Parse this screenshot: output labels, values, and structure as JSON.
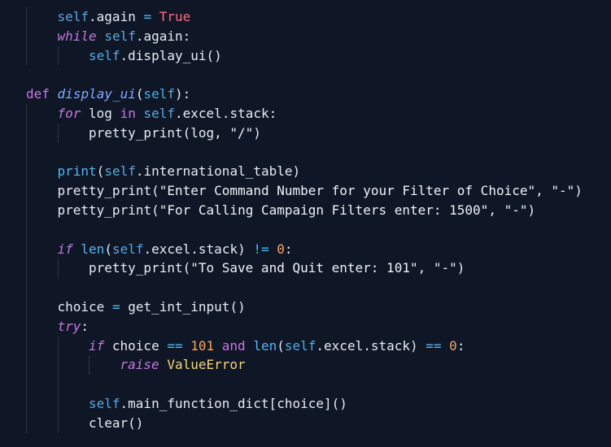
{
  "theme": {
    "background": "#0f1626",
    "keyword": "#c678dd",
    "self": "#56a9e0",
    "string": "#eef2f7",
    "number": "#f3a665",
    "boolean": "#ff6b81",
    "builtin": "#56b6f2",
    "class_name": "#f7d478",
    "def_name": "#82aaff"
  },
  "code": {
    "lines": [
      {
        "indent": 1,
        "tokens": [
          {
            "t": "self",
            "k": "self"
          },
          {
            "t": ".again ",
            "k": "plain"
          },
          {
            "t": "=",
            "k": "op"
          },
          {
            "t": " ",
            "k": "plain"
          },
          {
            "t": "True",
            "k": "bool"
          }
        ]
      },
      {
        "indent": 1,
        "tokens": [
          {
            "t": "while",
            "k": "kw-i"
          },
          {
            "t": " ",
            "k": "plain"
          },
          {
            "t": "self",
            "k": "self"
          },
          {
            "t": ".again:",
            "k": "plain"
          }
        ]
      },
      {
        "indent": 2,
        "tokens": [
          {
            "t": "self",
            "k": "self"
          },
          {
            "t": ".display_ui()",
            "k": "plain"
          }
        ]
      },
      {
        "indent": 0,
        "tokens": []
      },
      {
        "indent": 0,
        "tokens": [
          {
            "t": "def",
            "k": "kw"
          },
          {
            "t": " ",
            "k": "plain"
          },
          {
            "t": "display_ui",
            "k": "deffn"
          },
          {
            "t": "(",
            "k": "plain"
          },
          {
            "t": "self",
            "k": "self"
          },
          {
            "t": "):",
            "k": "plain"
          }
        ]
      },
      {
        "indent": 1,
        "tokens": [
          {
            "t": "for",
            "k": "kw-i"
          },
          {
            "t": " log ",
            "k": "plain"
          },
          {
            "t": "in",
            "k": "kw"
          },
          {
            "t": " ",
            "k": "plain"
          },
          {
            "t": "self",
            "k": "self"
          },
          {
            "t": ".excel.stack:",
            "k": "plain"
          }
        ]
      },
      {
        "indent": 2,
        "tokens": [
          {
            "t": "pretty_print(log, ",
            "k": "plain"
          },
          {
            "t": "\"/\"",
            "k": "str"
          },
          {
            "t": ")",
            "k": "plain"
          }
        ]
      },
      {
        "indent": 0,
        "tokens": []
      },
      {
        "indent": 1,
        "tokens": [
          {
            "t": "print",
            "k": "builtin"
          },
          {
            "t": "(",
            "k": "plain"
          },
          {
            "t": "self",
            "k": "self"
          },
          {
            "t": ".international_table)",
            "k": "plain"
          }
        ]
      },
      {
        "indent": 1,
        "tokens": [
          {
            "t": "pretty_print(",
            "k": "plain"
          },
          {
            "t": "\"Enter Command Number for your Filter of Choice\"",
            "k": "str"
          },
          {
            "t": ", ",
            "k": "plain"
          },
          {
            "t": "\"-\"",
            "k": "str"
          },
          {
            "t": ")",
            "k": "plain"
          }
        ]
      },
      {
        "indent": 1,
        "tokens": [
          {
            "t": "pretty_print(",
            "k": "plain"
          },
          {
            "t": "\"For Calling Campaign Filters enter: 1500\"",
            "k": "str"
          },
          {
            "t": ", ",
            "k": "plain"
          },
          {
            "t": "\"-\"",
            "k": "str"
          },
          {
            "t": ")",
            "k": "plain"
          }
        ]
      },
      {
        "indent": 0,
        "tokens": []
      },
      {
        "indent": 1,
        "tokens": [
          {
            "t": "if",
            "k": "kw-i"
          },
          {
            "t": " ",
            "k": "plain"
          },
          {
            "t": "len",
            "k": "builtin"
          },
          {
            "t": "(",
            "k": "plain"
          },
          {
            "t": "self",
            "k": "self"
          },
          {
            "t": ".excel.stack) ",
            "k": "plain"
          },
          {
            "t": "!=",
            "k": "op"
          },
          {
            "t": " ",
            "k": "plain"
          },
          {
            "t": "0",
            "k": "num"
          },
          {
            "t": ":",
            "k": "plain"
          }
        ]
      },
      {
        "indent": 2,
        "tokens": [
          {
            "t": "pretty_print(",
            "k": "plain"
          },
          {
            "t": "\"To Save and Quit enter: 101\"",
            "k": "str"
          },
          {
            "t": ", ",
            "k": "plain"
          },
          {
            "t": "\"-\"",
            "k": "str"
          },
          {
            "t": ")",
            "k": "plain"
          }
        ]
      },
      {
        "indent": 0,
        "tokens": []
      },
      {
        "indent": 1,
        "tokens": [
          {
            "t": "choice ",
            "k": "plain"
          },
          {
            "t": "=",
            "k": "op"
          },
          {
            "t": " get_int_input()",
            "k": "plain"
          }
        ]
      },
      {
        "indent": 1,
        "tokens": [
          {
            "t": "try",
            "k": "kw-i"
          },
          {
            "t": ":",
            "k": "plain"
          }
        ]
      },
      {
        "indent": 2,
        "tokens": [
          {
            "t": "if",
            "k": "kw-i"
          },
          {
            "t": " choice ",
            "k": "plain"
          },
          {
            "t": "==",
            "k": "op"
          },
          {
            "t": " ",
            "k": "plain"
          },
          {
            "t": "101",
            "k": "num"
          },
          {
            "t": " ",
            "k": "plain"
          },
          {
            "t": "and",
            "k": "kw"
          },
          {
            "t": " ",
            "k": "plain"
          },
          {
            "t": "len",
            "k": "builtin"
          },
          {
            "t": "(",
            "k": "plain"
          },
          {
            "t": "self",
            "k": "self"
          },
          {
            "t": ".excel.stack) ",
            "k": "plain"
          },
          {
            "t": "==",
            "k": "op"
          },
          {
            "t": " ",
            "k": "plain"
          },
          {
            "t": "0",
            "k": "num"
          },
          {
            "t": ":",
            "k": "plain"
          }
        ]
      },
      {
        "indent": 3,
        "tokens": [
          {
            "t": "raise",
            "k": "kw-i"
          },
          {
            "t": " ",
            "k": "plain"
          },
          {
            "t": "ValueError",
            "k": "cls"
          }
        ]
      },
      {
        "indent": 0,
        "tokens": []
      },
      {
        "indent": 2,
        "tokens": [
          {
            "t": "self",
            "k": "self"
          },
          {
            "t": ".main_function_dict[choice]()",
            "k": "plain"
          }
        ]
      },
      {
        "indent": 2,
        "tokens": [
          {
            "t": "clear()",
            "k": "plain"
          }
        ]
      }
    ]
  }
}
